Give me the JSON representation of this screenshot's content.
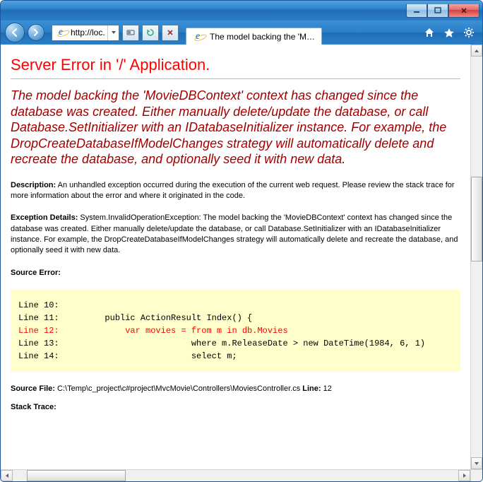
{
  "window": {
    "min_icon": "minimize",
    "max_icon": "maximize",
    "close_icon": "close"
  },
  "nav": {
    "url_display": "http://loc...",
    "tab_title": "The model backing the 'Movi..."
  },
  "error": {
    "title": "Server Error in '/' Application.",
    "message": "The model backing the 'MovieDBContext' context has changed since the database was created. Either manually delete/update the database, or call Database.SetInitializer with an IDatabaseInitializer instance. For example, the DropCreateDatabaseIfModelChanges strategy will automatically delete and recreate the database, and optionally seed it with new data.",
    "description_label": "Description:",
    "description_text": " An unhandled exception occurred during the execution of the current web request. Please review the stack trace for more information about the error and where it originated in the code.",
    "exception_label": "Exception Details:",
    "exception_text": " System.InvalidOperationException: The model backing the 'MovieDBContext' context has changed since the database was created. Either manually delete/update the database, or call Database.SetInitializer with an IDatabaseInitializer instance. For example, the DropCreateDatabaseIfModelChanges strategy will automatically delete and recreate the database, and optionally seed it with new data.",
    "source_error_label": "Source Error:",
    "source": {
      "line10": "Line 10:",
      "line11": "Line 11:         public ActionResult Index() {",
      "line12": "Line 12:             var movies = from m in db.Movies",
      "line13": "Line 13:                          where m.ReleaseDate > new DateTime(1984, 6, 1)",
      "line14": "Line 14:                          select m;"
    },
    "source_file_label": "Source File:",
    "source_file_path": " C:\\Temp\\c_project\\c#project\\MvcMovie\\Controllers\\MoviesController.cs    ",
    "line_label": "Line:",
    "line_number": " 12",
    "stack_trace_label": "Stack Trace:"
  }
}
